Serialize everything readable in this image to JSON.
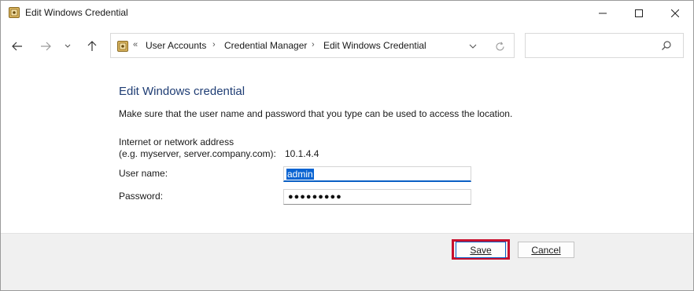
{
  "window": {
    "title": "Edit Windows Credential"
  },
  "titlebar": {
    "icons": [
      "credential-manager-icon",
      "minimize-icon",
      "maximize-icon",
      "close-icon"
    ]
  },
  "navigation": {
    "icons": [
      "back-arrow-icon",
      "forward-arrow-icon",
      "chevron-down-icon",
      "up-arrow-icon"
    ],
    "address_overflow": "«",
    "breadcrumbs": [
      "User Accounts",
      "Credential Manager",
      "Edit Windows Credential"
    ],
    "separator": "›",
    "search_placeholder": ""
  },
  "form": {
    "heading": "Edit Windows credential",
    "description": "Make sure that the user name and password that you type can be used to access the location.",
    "address_label_line1": "Internet or network address",
    "address_label_line2": "(e.g. myserver, server.company.com):",
    "address_value": "10.1.4.4",
    "username_label": "User name:",
    "username_value": "admin",
    "password_label": "Password:",
    "password_mask": "●●●●●●●●●"
  },
  "buttons": {
    "save": "Save",
    "cancel": "Cancel"
  },
  "colors": {
    "heading": "#1f3d74",
    "selection": "#0a64d2",
    "highlight": "#c8102e"
  }
}
